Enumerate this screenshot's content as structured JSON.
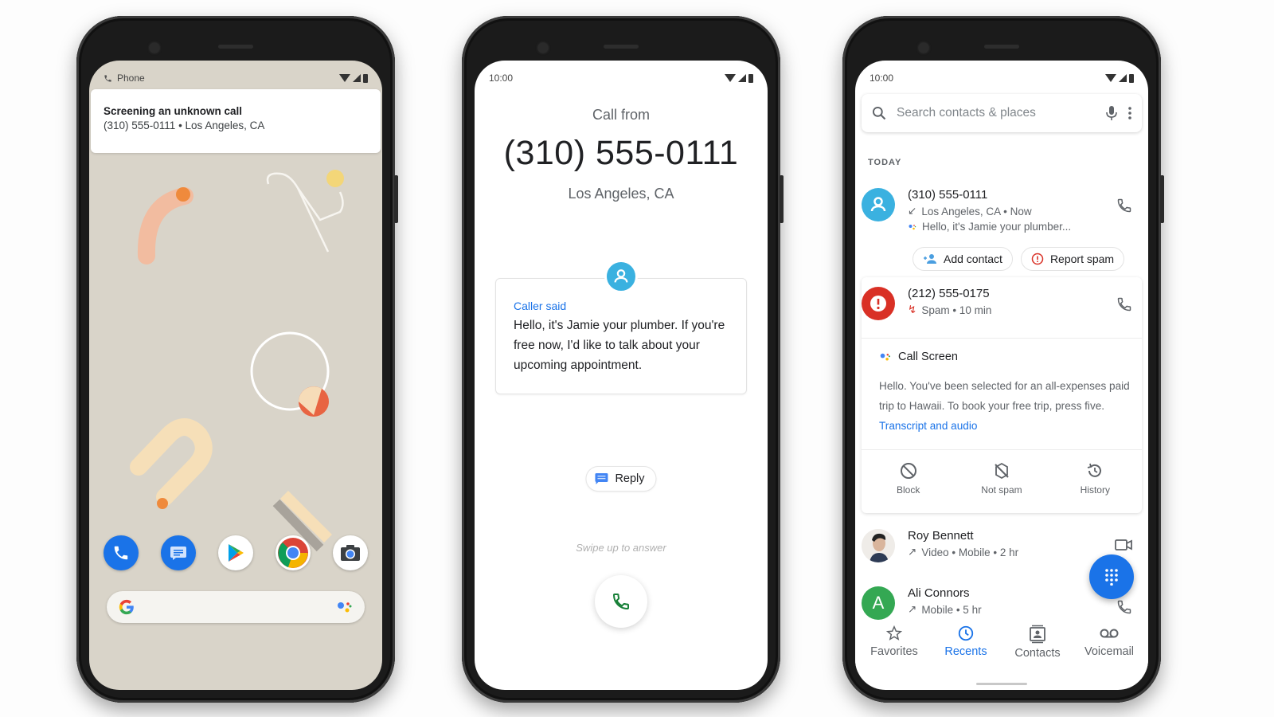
{
  "phone1": {
    "status_app": "Phone",
    "notification": {
      "title": "Screening an unknown call",
      "subtitle": "(310) 555-0111 • Los Angeles, CA"
    },
    "dock_apps": [
      "phone-app",
      "messages-app",
      "play-store-app",
      "chrome-app",
      "camera-app"
    ],
    "search_bar_logo": "G"
  },
  "phone2": {
    "time": "10:00",
    "call_from_label": "Call from",
    "number": "(310) 555-0111",
    "location": "Los Angeles, CA",
    "caller_said_label": "Caller said",
    "caller_said_text": "Hello, it's Jamie your plumber. If you're free now, I'd like to talk about your upcoming appointment.",
    "reply_label": "Reply",
    "swipe_hint": "Swipe up to answer"
  },
  "phone3": {
    "time": "10:00",
    "search_placeholder": "Search contacts & places",
    "section_label": "TODAY",
    "calls": [
      {
        "name": "(310) 555-0111",
        "detail": "Los Angeles, CA • Now",
        "direction": "incoming",
        "transcript": "Hello, it's Jamie your plumber..."
      },
      {
        "name": "(212) 555-0175",
        "detail": "Spam • 10 min",
        "direction": "spam"
      },
      {
        "name": "Roy Bennett",
        "detail": "Video • Mobile • 2 hr",
        "direction": "outgoing"
      },
      {
        "name": "Ali Connors",
        "detail": "Mobile • 5 hr",
        "direction": "outgoing",
        "initial": "A"
      }
    ],
    "add_contact_label": "Add contact",
    "report_spam_label": "Report spam",
    "call_screen": {
      "title": "Call Screen",
      "text": "Hello. You've been selected for an all-expenses paid trip to Hawaii. To book your free trip, press five.",
      "link": "Transcript and audio"
    },
    "actions": [
      {
        "label": "Block",
        "icon": "block-icon"
      },
      {
        "label": "Not spam",
        "icon": "not-spam-icon"
      },
      {
        "label": "History",
        "icon": "history-icon"
      }
    ],
    "nav": [
      {
        "label": "Favorites",
        "icon": "star-icon",
        "active": false
      },
      {
        "label": "Recents",
        "icon": "clock-icon",
        "active": true
      },
      {
        "label": "Contacts",
        "icon": "contacts-icon",
        "active": false
      },
      {
        "label": "Voicemail",
        "icon": "voicemail-icon",
        "active": false
      }
    ]
  },
  "colors": {
    "accent_blue": "#1a73e8",
    "spam_red": "#d93025",
    "avatar_cyan": "#3ab1e0",
    "avatar_green": "#34a853",
    "wallpaper": "#d9d4c9"
  }
}
